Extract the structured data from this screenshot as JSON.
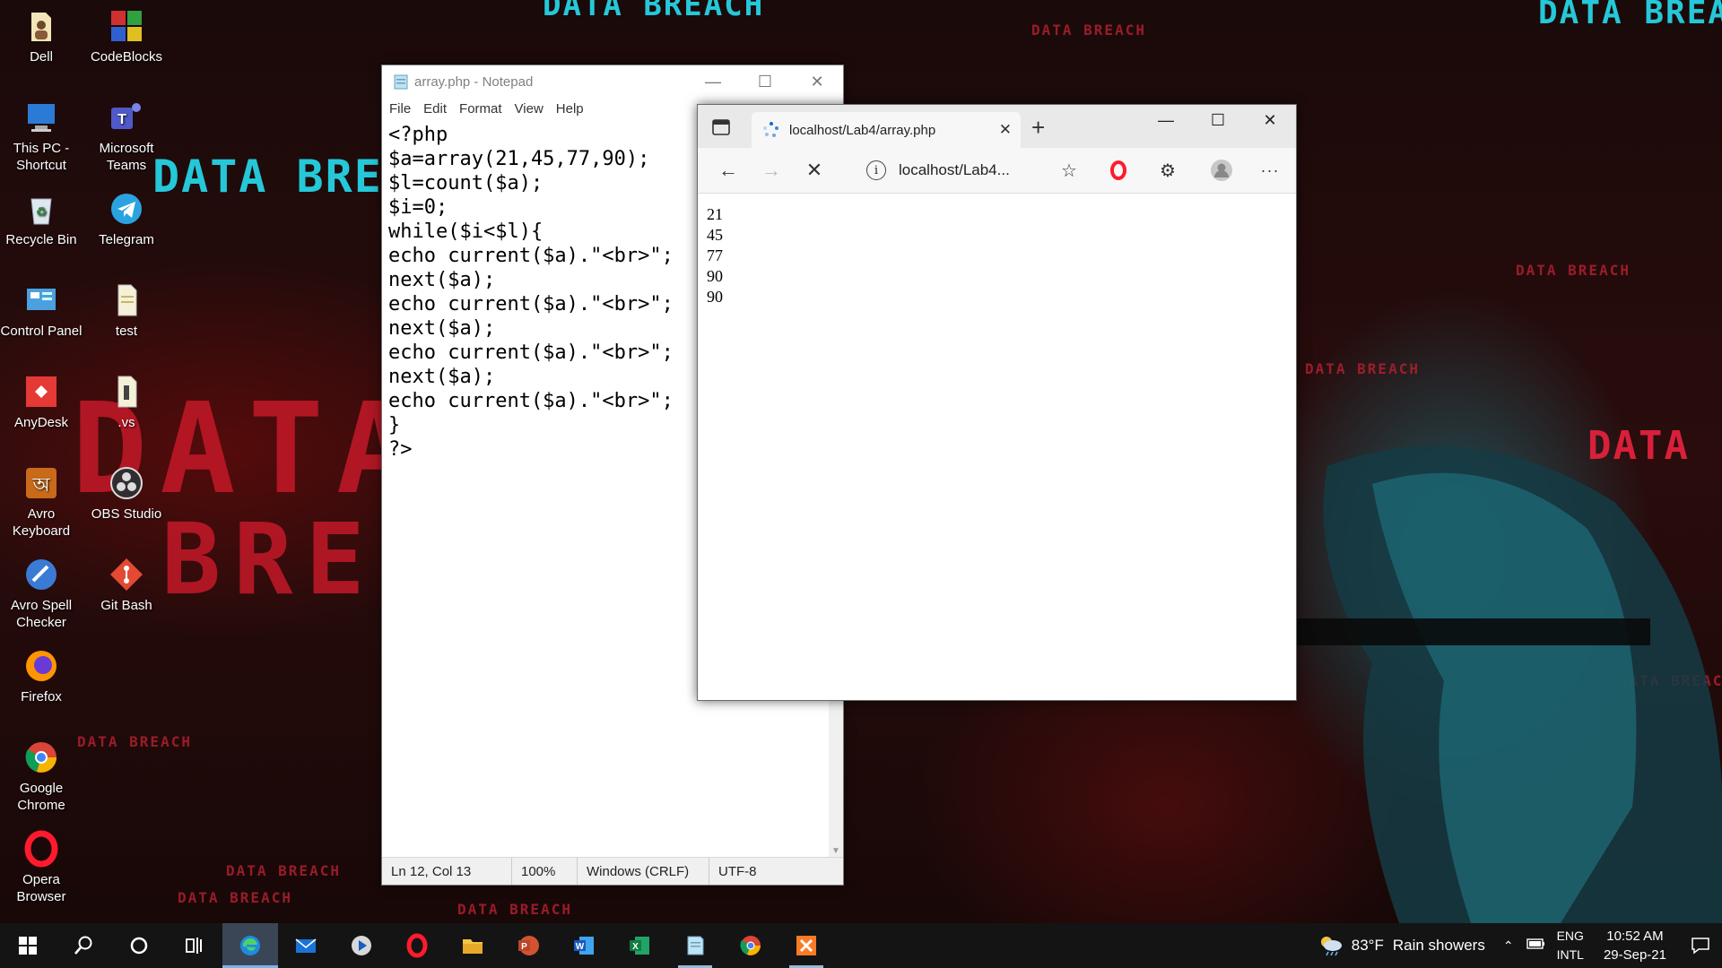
{
  "desktop": {
    "wallpaper_text": {
      "banner": "DATA BREACH",
      "pixel_word_1": "DATA",
      "pixel_word_2": "BRE",
      "side_word": "DATA"
    },
    "icons": [
      {
        "label": "Dell",
        "icon": "folder-user-icon"
      },
      {
        "label": "CodeBlocks",
        "icon": "codeblocks-icon"
      },
      {
        "label": "This PC - Shortcut",
        "icon": "computer-icon"
      },
      {
        "label": "Microsoft Teams",
        "icon": "teams-icon"
      },
      {
        "label": "Recycle Bin",
        "icon": "recycle-bin-icon"
      },
      {
        "label": "Telegram",
        "icon": "telegram-icon"
      },
      {
        "label": "Control Panel",
        "icon": "control-panel-icon"
      },
      {
        "label": "test",
        "icon": "document-icon"
      },
      {
        "label": "AnyDesk",
        "icon": "anydesk-icon"
      },
      {
        "label": ".vs",
        "icon": "vs-file-icon"
      },
      {
        "label": "Avro Keyboard",
        "icon": "avro-keyboard-icon"
      },
      {
        "label": "OBS Studio",
        "icon": "obs-icon"
      },
      {
        "label": "Avro Spell Checker",
        "icon": "avro-spell-icon"
      },
      {
        "label": "Git Bash",
        "icon": "git-bash-icon"
      },
      {
        "label": "Firefox",
        "icon": "firefox-icon"
      },
      {
        "label": "Google Chrome",
        "icon": "chrome-icon"
      },
      {
        "label": "Opera Browser",
        "icon": "opera-icon"
      }
    ]
  },
  "notepad": {
    "title": "array.php - Notepad",
    "menu": [
      "File",
      "Edit",
      "Format",
      "View",
      "Help"
    ],
    "content": "<?php\n$a=array(21,45,77,90);\n$l=count($a);\n$i=0;\nwhile($i<$l){\necho current($a).\"<br>\";\nnext($a);\necho current($a).\"<br>\";\nnext($a);\necho current($a).\"<br>\";\nnext($a);\necho current($a).\"<br>\";\n}\n?>",
    "status": {
      "position": "Ln 12, Col 13",
      "zoom": "100%",
      "line_ending": "Windows (CRLF)",
      "encoding": "UTF-8"
    }
  },
  "browser": {
    "tab_title": "localhost/Lab4/array.php",
    "address": "localhost/Lab4...",
    "output_lines": [
      "21",
      "45",
      "77",
      "90",
      "90"
    ]
  },
  "taskbar": {
    "apps": [
      "start",
      "search",
      "cortana",
      "task-view",
      "edge",
      "mail",
      "media-player",
      "opera",
      "file-explorer",
      "powerpoint",
      "word",
      "excel",
      "notepad",
      "chrome",
      "xampp"
    ],
    "weather": {
      "temperature": "83°F",
      "condition": "Rain showers"
    },
    "language": {
      "line1": "ENG",
      "line2": "INTL"
    },
    "clock": {
      "time": "10:52 AM",
      "date": "29-Sep-21"
    }
  },
  "colors": {
    "accent_cyan": "#25c8d8",
    "wallpaper_red": "#d8203a",
    "opera_red": "#ff1b2d",
    "taskbar": "#141414"
  }
}
